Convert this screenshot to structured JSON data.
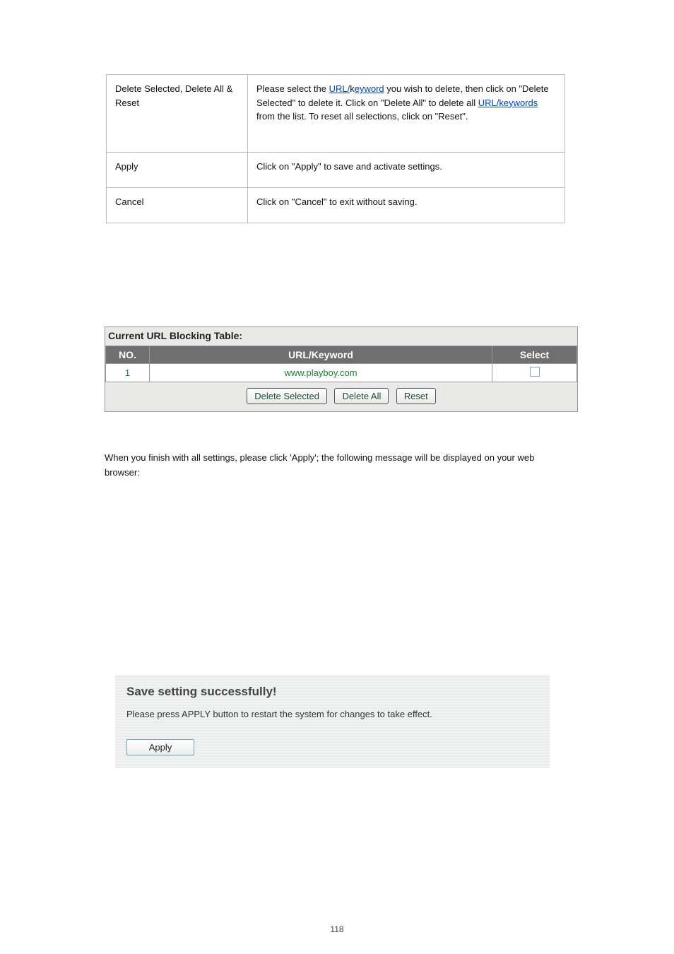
{
  "desc": {
    "rows": [
      {
        "label": "Delete Selected, Delete All & Reset",
        "text_parts": [
          "Please select the ",
          " you wish to delete, then click on \"Delete Selected\" to delete it. Click on \"Delete All\" to delete all ",
          " from the list. To reset all selections, click on \"Reset\"."
        ],
        "link1": "URL/",
        "span1": "k",
        "link2": "eyword"
      },
      {
        "label": "Apply",
        "text": "Click on \"Apply\" to save and activate settings."
      },
      {
        "label": "Cancel",
        "text": "Click on \"Cancel\" to exit without saving."
      }
    ]
  },
  "block_table": {
    "title": "Current URL Blocking Table:",
    "headers": {
      "no": "NO.",
      "key": "URL/Keyword",
      "sel": "Select"
    },
    "rows": [
      {
        "no": "1",
        "keyword": "www.playboy.com"
      }
    ],
    "buttons": {
      "delete_selected": "Delete Selected",
      "delete_all": "Delete All",
      "reset": "Reset"
    }
  },
  "note": "When you finish with all settings, please click 'Apply'; the following message will be displayed on your web browser:",
  "save_panel": {
    "title": "Save setting successfully!",
    "msg": "Please press APPLY button to restart the system for changes to take effect.",
    "apply_label": "Apply"
  },
  "page_number": "118"
}
